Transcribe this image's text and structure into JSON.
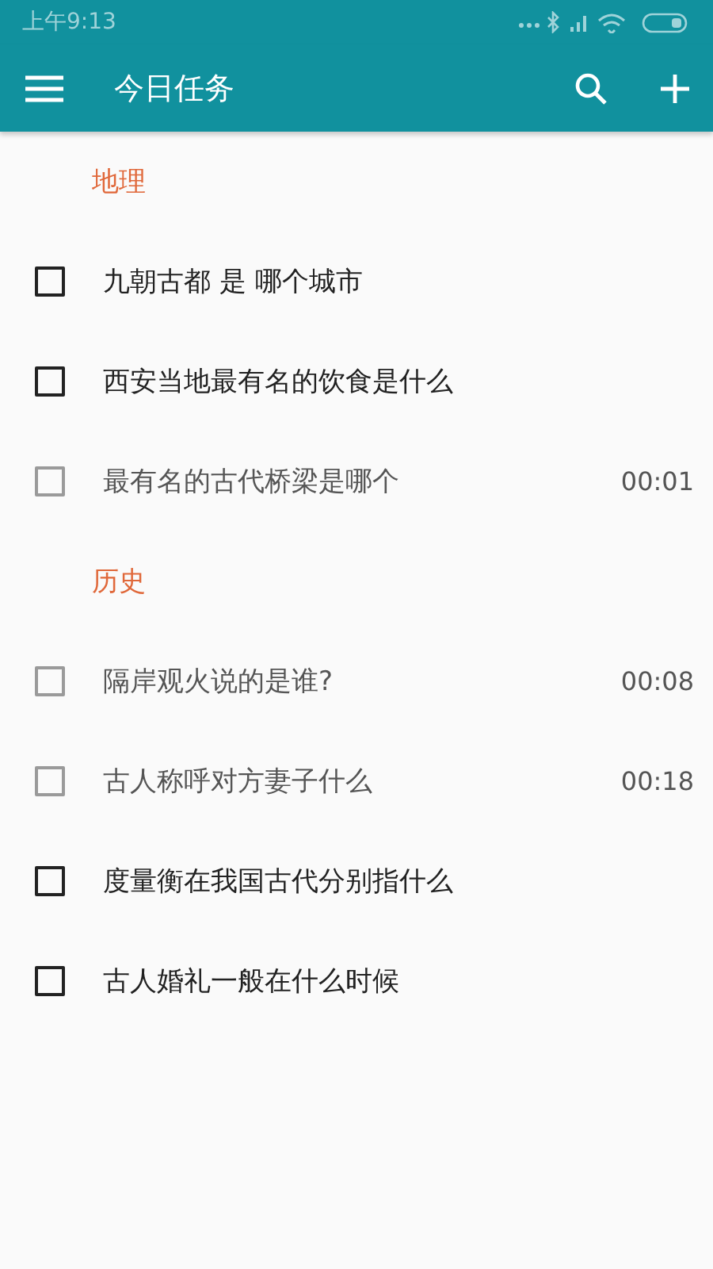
{
  "status_bar": {
    "time": "上午9:13"
  },
  "app_bar": {
    "title": "今日任务"
  },
  "sections": [
    {
      "title": "地理",
      "tasks": [
        {
          "label": "九朝古都 是 哪个城市",
          "disabled": false
        },
        {
          "label": "西安当地最有名的饮食是什么",
          "disabled": false
        },
        {
          "label": "最有名的古代桥梁是哪个",
          "disabled": true,
          "time": "00:01"
        }
      ]
    },
    {
      "title": "历史",
      "tasks": [
        {
          "label": "隔岸观火说的是谁?",
          "disabled": true,
          "time": "00:08"
        },
        {
          "label": "古人称呼对方妻子什么",
          "disabled": true,
          "time": "00:18"
        },
        {
          "label": "度量衡在我国古代分别指什么",
          "disabled": false
        },
        {
          "label": "古人婚礼一般在什么时候",
          "disabled": false
        }
      ]
    }
  ]
}
